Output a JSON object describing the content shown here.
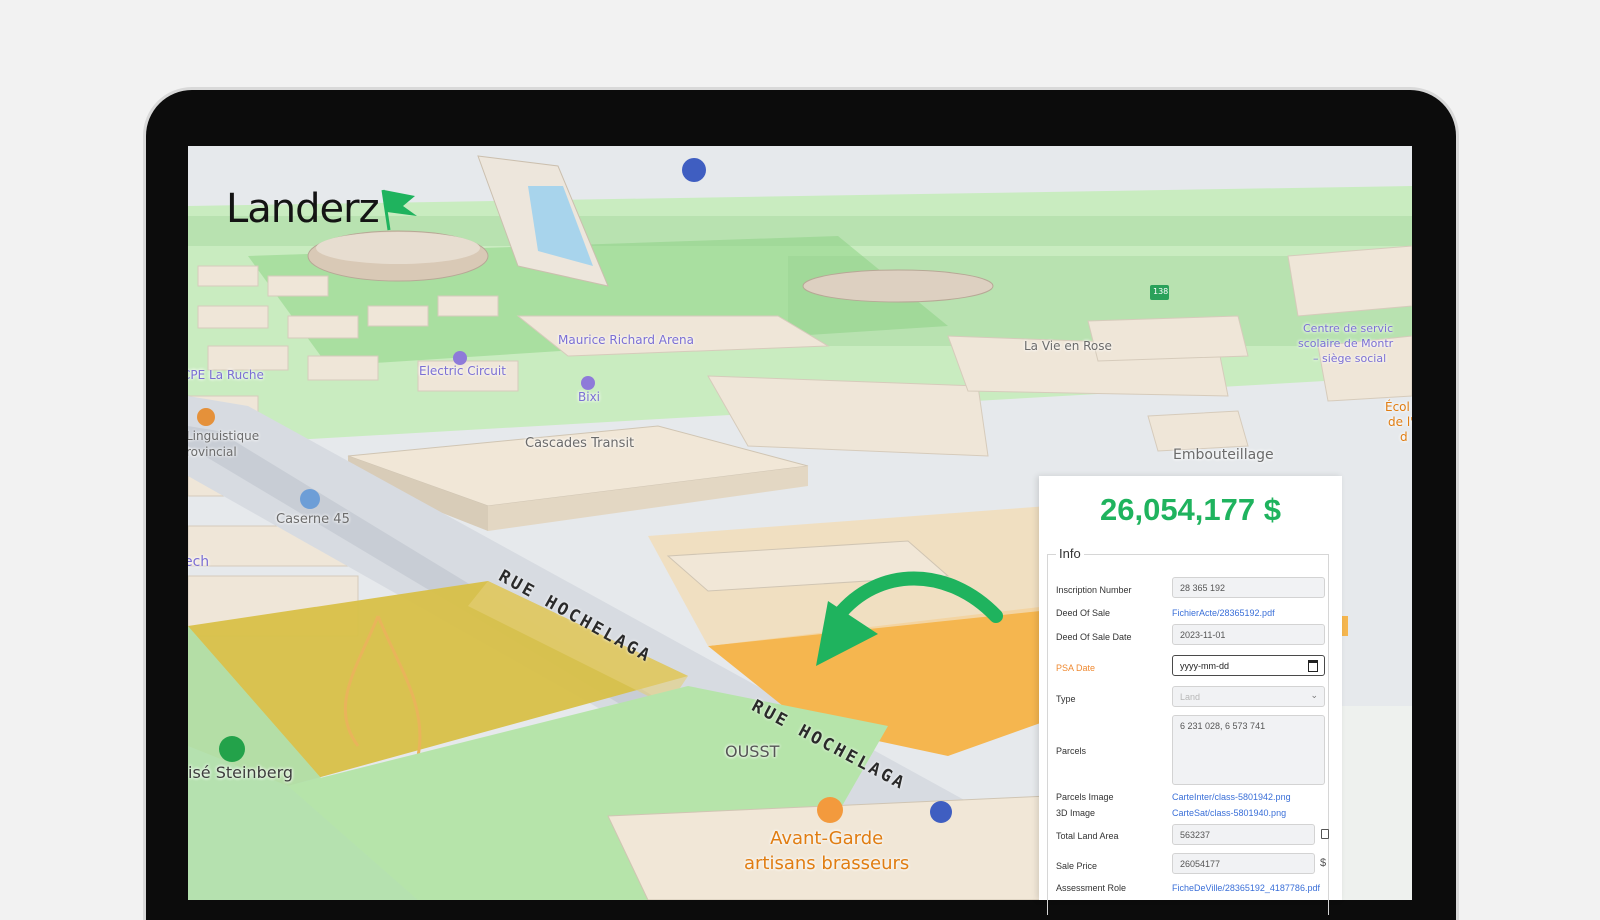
{
  "app": {
    "logo_text": "Landerz"
  },
  "map": {
    "pois": {
      "maurice_richard_arena": "Maurice Richard Arena",
      "electric_circuit": "Electric Circuit",
      "bixi": "Bixi",
      "cpe_la_ruche": "CPE La Ruche",
      "linguistique": "Linguistique",
      "provincial": "rovincial",
      "cascades_transit": "Cascades Transit",
      "caserne_45": "Caserne 45",
      "ech": "ech",
      "la_vie_en_rose": "La Vie en Rose",
      "centre_line1": "Centre de servic",
      "centre_line2": "scolaire de Montr",
      "centre_line3": "– siège social",
      "ecole_line1": "Écol",
      "ecole_line2": "de l'",
      "ecole_line3": "d",
      "embouteillage": "Embouteillage",
      "ousst": "OUSST",
      "avant_garde_line1": "Avant-Garde",
      "avant_garde_line2": "artisans brasseurs",
      "steinberg": "isé Steinberg",
      "route_shield": "138"
    },
    "streets": {
      "rue_hochelaga_1": "RUE HOCHELAGA",
      "rue_hochelaga_2": "RUE HOCHELAGA"
    },
    "colors": {
      "parcel_primary": "#f5b64f",
      "parcel_secondary": "#d8c048",
      "brand_green": "#1fb35e"
    }
  },
  "panel": {
    "price": "26,054,177 $",
    "section_title": "Info",
    "fields": {
      "inscription_number": {
        "label": "Inscription Number",
        "value": "28 365 192"
      },
      "deed_of_sale": {
        "label": "Deed Of Sale",
        "value": "FichierActe/28365192.pdf"
      },
      "deed_of_sale_date": {
        "label": "Deed Of Sale Date",
        "value": "2023-11-01"
      },
      "psa_date": {
        "label": "PSA Date",
        "placeholder": "yyyy-mm-dd"
      },
      "type": {
        "label": "Type",
        "value": "Land"
      },
      "parcels": {
        "label": "Parcels",
        "value": "6 231 028, 6 573 741"
      },
      "parcels_image": {
        "label": "Parcels Image",
        "value": "CarteInter/class-5801942.png"
      },
      "image_3d": {
        "label": "3D Image",
        "value": "CarteSat/class-5801940.png"
      },
      "total_land_area": {
        "label": "Total Land Area",
        "value": "563237"
      },
      "sale_price": {
        "label": "Sale Price",
        "value": "26054177",
        "suffix": "$"
      },
      "assessment_role": {
        "label": "Assessment Role",
        "value": "FicheDeVille/28365192_4187786.pdf"
      }
    }
  }
}
